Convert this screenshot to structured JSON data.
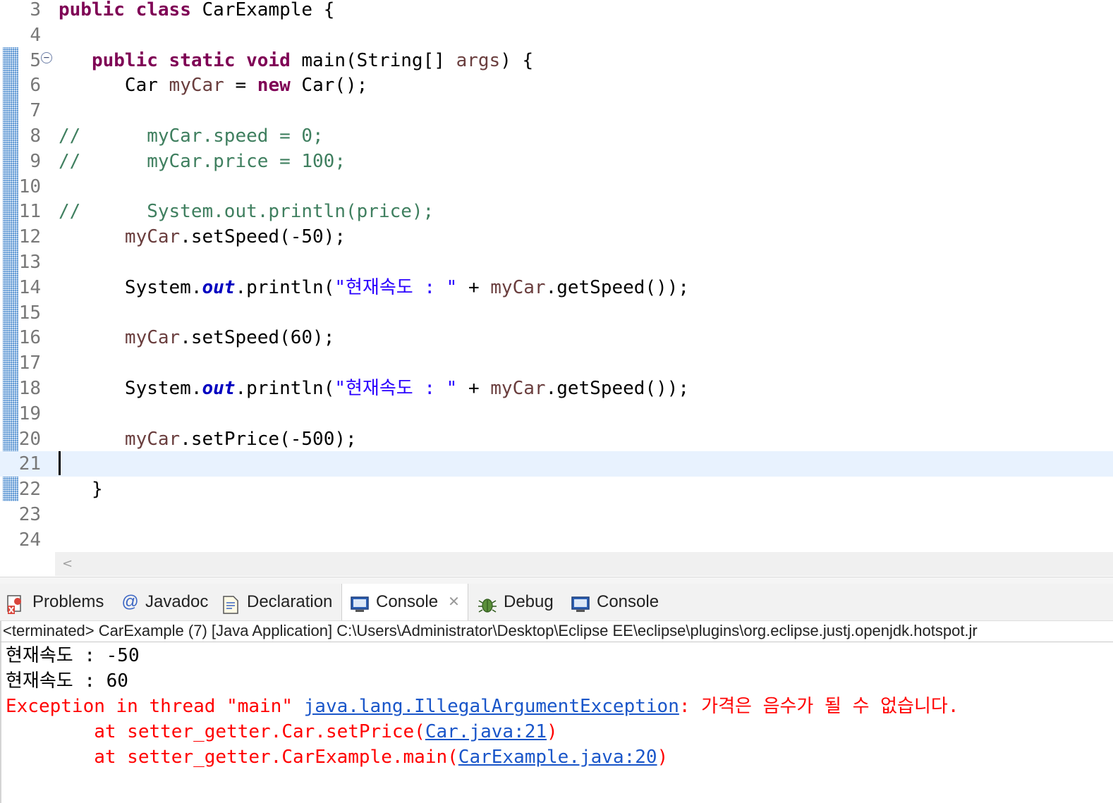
{
  "editor": {
    "lines": [
      {
        "num": "3",
        "segments": [
          {
            "t": "public",
            "c": "kw"
          },
          {
            "t": " "
          },
          {
            "t": "class",
            "c": "kw"
          },
          {
            "t": " CarExample {"
          }
        ]
      },
      {
        "num": "4",
        "segments": []
      },
      {
        "num": "5",
        "segments": [
          {
            "t": "   "
          },
          {
            "t": "public",
            "c": "kw"
          },
          {
            "t": " "
          },
          {
            "t": "static",
            "c": "kw"
          },
          {
            "t": " "
          },
          {
            "t": "void",
            "c": "kw"
          },
          {
            "t": " main(String[] "
          },
          {
            "t": "args",
            "c": "var"
          },
          {
            "t": ") {"
          }
        ],
        "fold": "−"
      },
      {
        "num": "6",
        "segments": [
          {
            "t": "      Car "
          },
          {
            "t": "myCar",
            "c": "var"
          },
          {
            "t": " = "
          },
          {
            "t": "new",
            "c": "kw"
          },
          {
            "t": " Car();"
          }
        ]
      },
      {
        "num": "7",
        "segments": []
      },
      {
        "num": "8",
        "segments": [
          {
            "t": "//      myCar.speed = 0;",
            "c": "cmt"
          }
        ]
      },
      {
        "num": "9",
        "segments": [
          {
            "t": "//      myCar.price = 100;",
            "c": "cmt"
          }
        ]
      },
      {
        "num": "10",
        "segments": []
      },
      {
        "num": "11",
        "segments": [
          {
            "t": "//      System.out.println(price);",
            "c": "cmt"
          }
        ]
      },
      {
        "num": "12",
        "segments": [
          {
            "t": "      "
          },
          {
            "t": "myCar",
            "c": "var"
          },
          {
            "t": ".setSpeed(-50);"
          }
        ]
      },
      {
        "num": "13",
        "segments": []
      },
      {
        "num": "14",
        "segments": [
          {
            "t": "      System."
          },
          {
            "t": "out",
            "c": "fld"
          },
          {
            "t": ".println("
          },
          {
            "t": "\"현재속도 : \"",
            "c": "str"
          },
          {
            "t": " + "
          },
          {
            "t": "myCar",
            "c": "var"
          },
          {
            "t": ".getSpeed());"
          }
        ]
      },
      {
        "num": "15",
        "segments": []
      },
      {
        "num": "16",
        "segments": [
          {
            "t": "      "
          },
          {
            "t": "myCar",
            "c": "var"
          },
          {
            "t": ".setSpeed(60);"
          }
        ]
      },
      {
        "num": "17",
        "segments": []
      },
      {
        "num": "18",
        "segments": [
          {
            "t": "      System."
          },
          {
            "t": "out",
            "c": "fld"
          },
          {
            "t": ".println("
          },
          {
            "t": "\"현재속도 : \"",
            "c": "str"
          },
          {
            "t": " + "
          },
          {
            "t": "myCar",
            "c": "var"
          },
          {
            "t": ".getSpeed());"
          }
        ]
      },
      {
        "num": "19",
        "segments": []
      },
      {
        "num": "20",
        "segments": [
          {
            "t": "      "
          },
          {
            "t": "myCar",
            "c": "var"
          },
          {
            "t": ".setPrice(-500);"
          }
        ]
      },
      {
        "num": "21",
        "segments": [],
        "current": true
      },
      {
        "num": "22",
        "segments": [
          {
            "t": "   }"
          }
        ]
      },
      {
        "num": "23",
        "segments": []
      },
      {
        "num": "24",
        "segments": []
      }
    ],
    "scroll_left_glyph": "<"
  },
  "tabs": [
    {
      "label": "Problems",
      "icon": "problems-icon"
    },
    {
      "label": "Javadoc",
      "icon": "at-icon"
    },
    {
      "label": "Declaration",
      "icon": "declaration-icon"
    },
    {
      "label": "Console",
      "icon": "console-icon",
      "active": true,
      "close": "✕"
    },
    {
      "label": "Debug",
      "icon": "bug-icon"
    },
    {
      "label": "Console",
      "icon": "console-icon"
    }
  ],
  "console": {
    "header": "<terminated> CarExample (7) [Java Application] C:\\Users\\Administrator\\Desktop\\Eclipse EE\\eclipse\\plugins\\org.eclipse.justj.openjdk.hotspot.jr",
    "output": [
      [
        {
          "t": "현재속도 : -50"
        }
      ],
      [
        {
          "t": "현재속도 : 60"
        }
      ],
      [
        {
          "t": "Exception in thread \"main\" ",
          "c": "err"
        },
        {
          "t": "java.lang.IllegalArgumentException",
          "c": "link"
        },
        {
          "t": ": 가격은 음수가 될 수 없습니다.",
          "c": "err"
        }
      ],
      [
        {
          "t": "        at setter_getter.Car.setPrice(",
          "c": "err"
        },
        {
          "t": "Car.java:21",
          "c": "link"
        },
        {
          "t": ")",
          "c": "err"
        }
      ],
      [
        {
          "t": "        at setter_getter.CarExample.main(",
          "c": "err"
        },
        {
          "t": "CarExample.java:20",
          "c": "link"
        },
        {
          "t": ")",
          "c": "err"
        }
      ]
    ]
  },
  "colors": {
    "keyword": "#7f0055",
    "string": "#2a00ff",
    "comment": "#3f7f5f",
    "variable": "#6a3e3e",
    "field": "#0000c0",
    "error": "#ff0000",
    "link": "#1a56c9",
    "current_line": "#e8f2fe"
  }
}
